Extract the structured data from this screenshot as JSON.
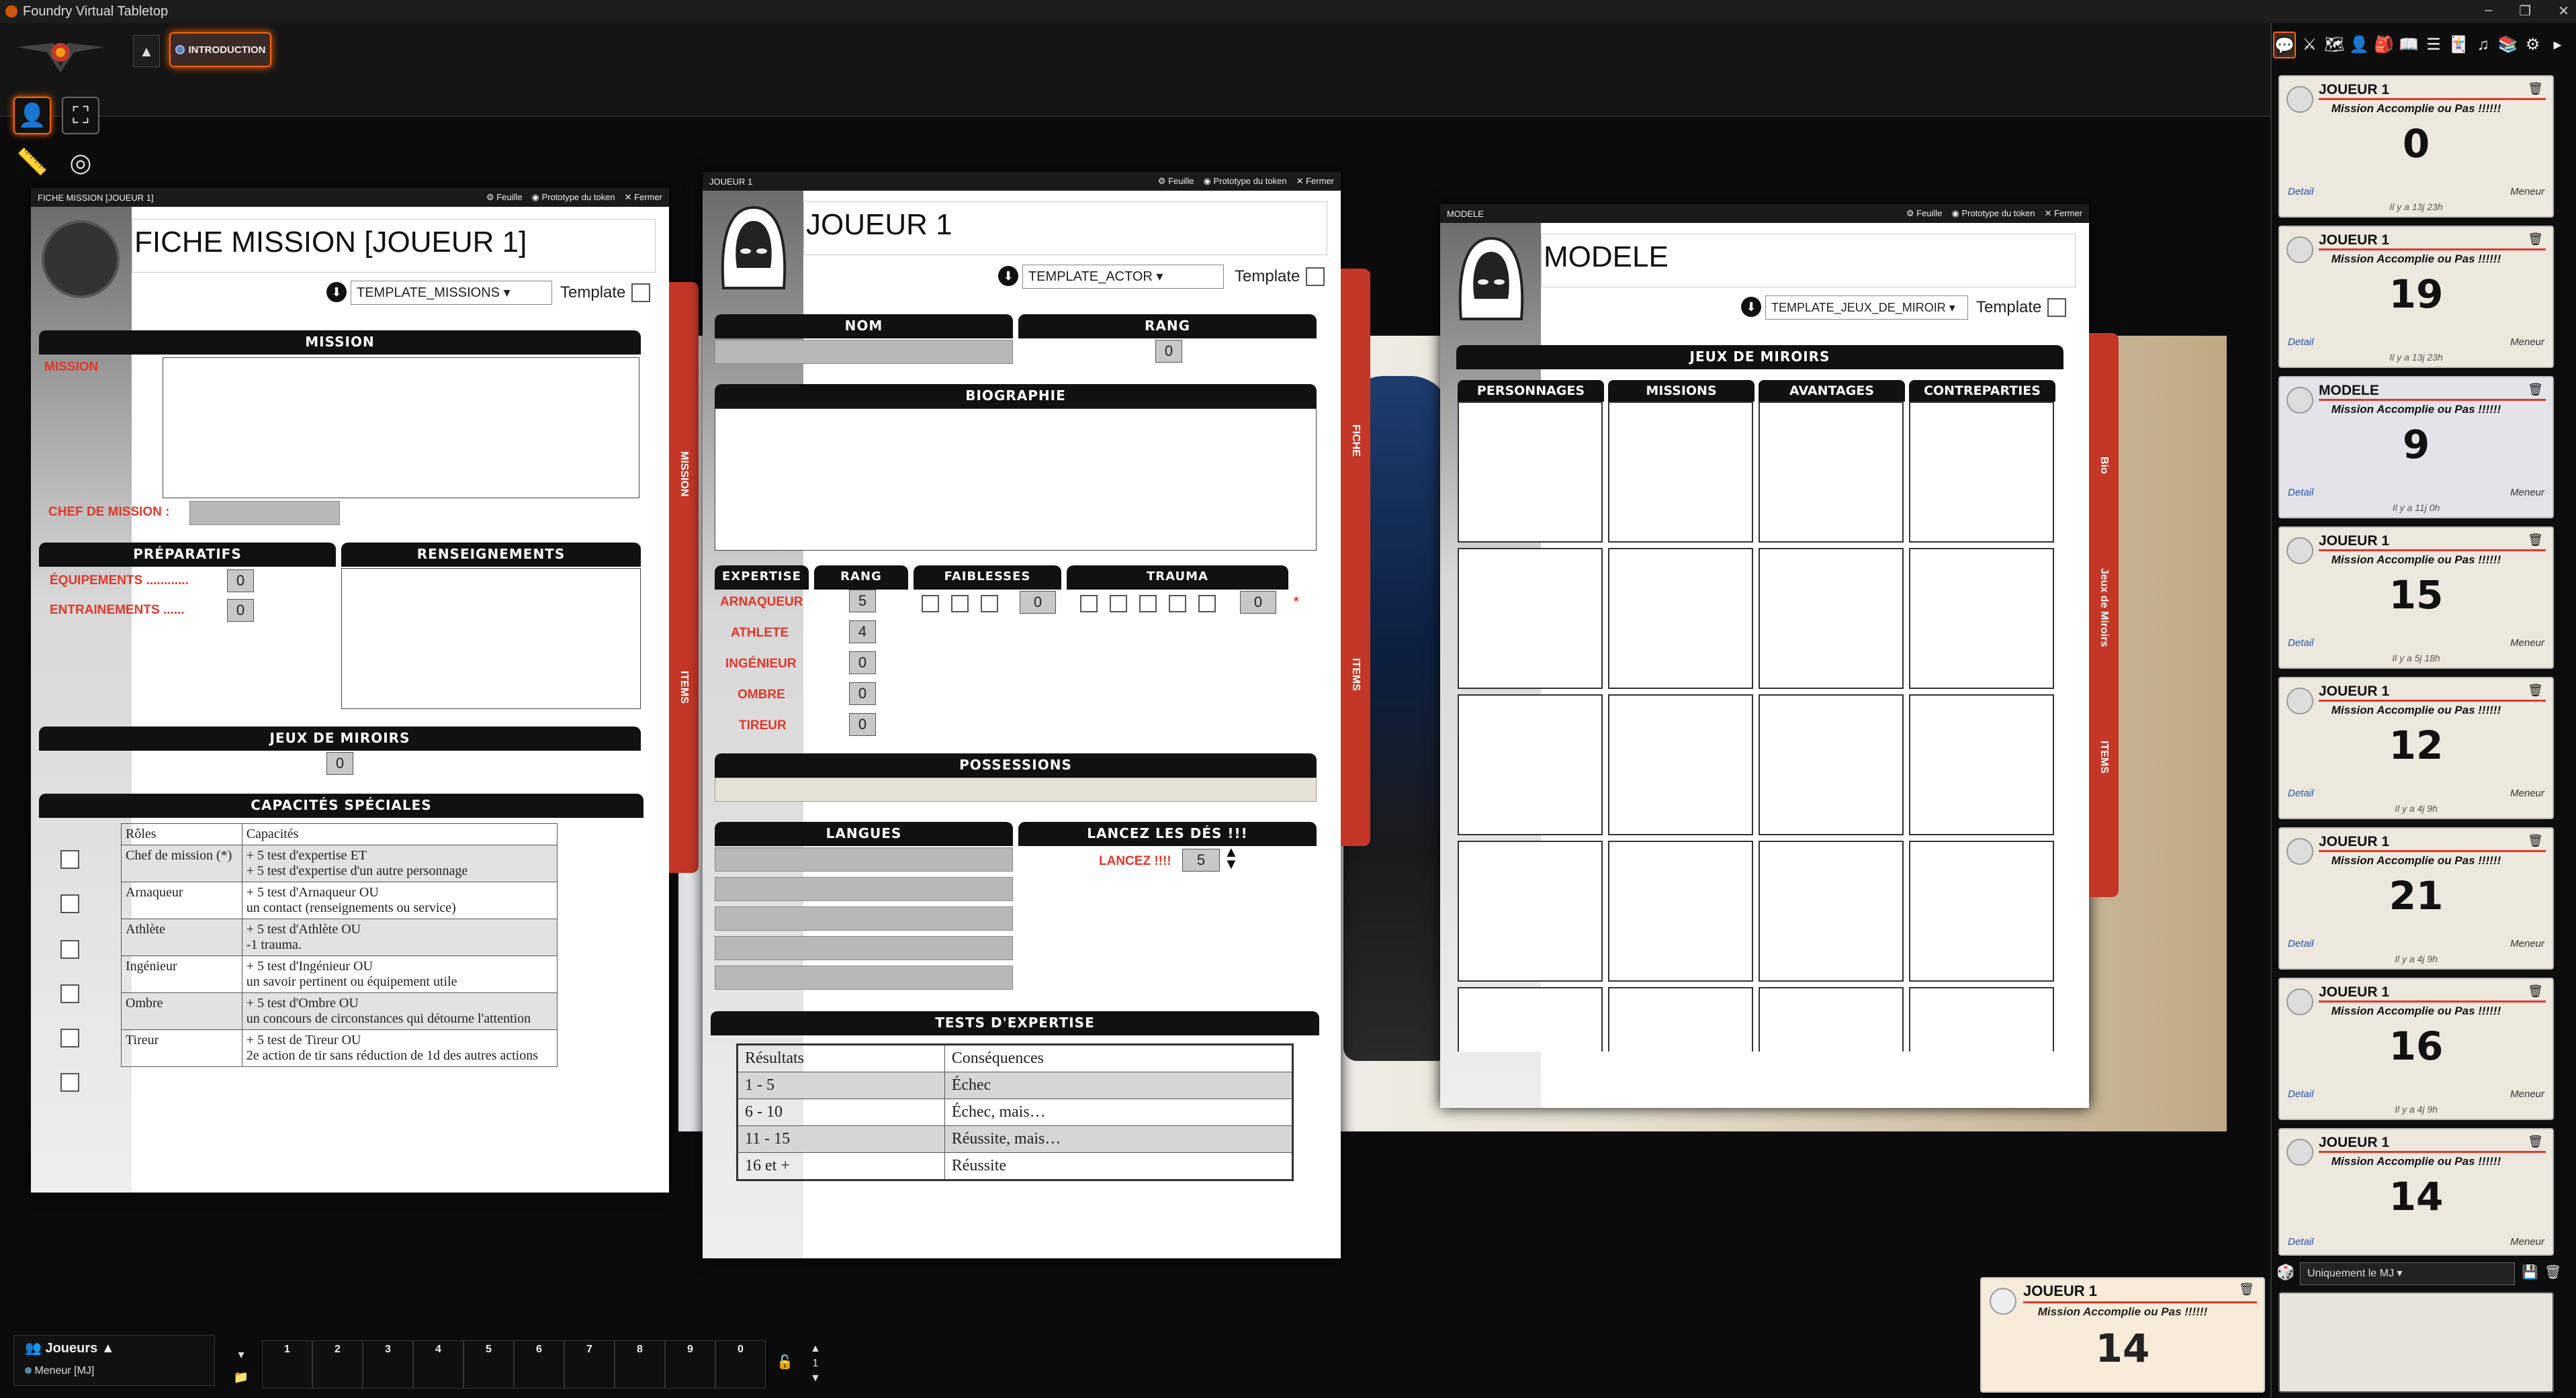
{
  "window": {
    "title": "Foundry Virtual Tabletop",
    "controls": [
      "–",
      "❐",
      "✕"
    ]
  },
  "scene_nav": {
    "active_scene": "INTRODUCTION"
  },
  "sheets": {
    "mission": {
      "header": "FICHE MISSION [JOUEUR 1]",
      "buttons": {
        "feuille": "Feuille",
        "prototype": "Prototype du token",
        "fermer": "Fermer"
      },
      "title": "FICHE MISSION [JOUEUR 1]",
      "template_select": "TEMPLATE_MISSIONS",
      "template_label": "Template",
      "mission_banner": "MISSION",
      "mission_label": "MISSION",
      "chef_label": "CHEF DE MISSION :",
      "preparatifs_banner": "PRÉPARATIFS",
      "renseignements_banner": "RENSEIGNEMENTS",
      "equipements_label": "ÉQUIPEMENTS ............",
      "equipements_value": "0",
      "entrainements_label": "ENTRAINEMENTS ......",
      "entrainements_value": "0",
      "miroirs_banner": "JEUX DE MIROIRS",
      "miroirs_value": "0",
      "capacites_banner": "CAPACITÉS SPÉCIALES",
      "caps_header": [
        "Rôles",
        "Capacités"
      ],
      "caps_rows": [
        [
          "Chef de mission (*)",
          "+ 5 test d'expertise ET",
          "+ 5 test d'expertise d'un autre personnage"
        ],
        [
          "Arnaqueur",
          "+ 5 test d'Arnaqueur OU",
          "un contact (renseignements ou service)"
        ],
        [
          "Athlète",
          "+ 5 test d'Athlète OU",
          "-1 trauma."
        ],
        [
          "Ingénieur",
          "+ 5 test d'Ingénieur OU",
          "un savoir pertinent ou équipement utile"
        ],
        [
          "Ombre",
          "+ 5 test d'Ombre OU",
          "un concours de circonstances qui détourne l'attention"
        ],
        [
          "Tireur",
          "+ 5 test de Tireur OU",
          "2e action de tir sans réduction de 1d des autres actions"
        ]
      ],
      "tabs": [
        "MISSION",
        "ITEMS"
      ]
    },
    "actor": {
      "header": "JOUEUR 1",
      "buttons": {
        "feuille": "Feuille",
        "prototype": "Prototype du token",
        "fermer": "Fermer"
      },
      "title": "JOUEUR 1",
      "template_select": "TEMPLATE_ACTOR",
      "template_label": "Template",
      "nom_banner": "NOM",
      "rang_banner": "RANG",
      "rang_value": "0",
      "bio_banner": "BIOGRAPHIE",
      "expertise_banner": "EXPERTISE",
      "rang_col_banner": "RANG",
      "faiblesses_banner": "FAIBLESSES",
      "trauma_banner": "TRAUMA",
      "expertises": [
        {
          "label": "ARNAQUEUR",
          "value": "5"
        },
        {
          "label": "ATHLETE",
          "value": "4"
        },
        {
          "label": "INGÉNIEUR",
          "value": "0"
        },
        {
          "label": "OMBRE",
          "value": "0"
        },
        {
          "label": "TIREUR",
          "value": "0"
        }
      ],
      "faiblesses_value": "0",
      "trauma_value": "0",
      "star": "*",
      "possessions_banner": "POSSESSIONS",
      "langues_banner": "LANGUES",
      "lancez_banner": "LANCEZ LES DÉS !!!",
      "lancez_label": "LANCEZ !!!!",
      "lancez_value": "5",
      "tests_banner": "TESTS D'EXPERTISE",
      "res_header": [
        "Résultats",
        "Conséquences"
      ],
      "res_rows": [
        [
          "1 - 5",
          "Échec"
        ],
        [
          "6 - 10",
          "Échec, mais…"
        ],
        [
          "11 - 15",
          "Réussite, mais…"
        ],
        [
          "16 et +",
          "Réussite"
        ]
      ],
      "tabs": [
        "FICHE",
        "ITEMS"
      ]
    },
    "modele": {
      "header": "MODELE",
      "buttons": {
        "feuille": "Feuille",
        "prototype": "Prototype du token",
        "fermer": "Fermer"
      },
      "title": "MODELE",
      "template_select": "TEMPLATE_JEUX_DE_MIROIR",
      "template_label": "Template",
      "miroirs_banner": "JEUX DE MIROIRS",
      "cols": [
        "PERSONNAGES",
        "MISSIONS",
        "AVANTAGES",
        "CONTREPARTIES"
      ],
      "tabs": [
        "Bio",
        "Jeux de Miroirs",
        "ITEMS"
      ]
    }
  },
  "chat": {
    "flavor": "Mission Accomplie ou Pas !!!!!!",
    "detail": "Detail",
    "meneur": "Meneur",
    "messages": [
      {
        "who": "JOUEUR 1",
        "result": "0",
        "ts": "Il y a 13j 23h"
      },
      {
        "who": "JOUEUR 1",
        "result": "19",
        "ts": "Il y a 13j 23h"
      },
      {
        "who": "MODELE",
        "result": "9",
        "ts": "Il y a 11j 0h"
      },
      {
        "who": "JOUEUR 1",
        "result": "15",
        "ts": "Il y a 5j 18h"
      },
      {
        "who": "JOUEUR 1",
        "result": "12",
        "ts": "Il y a 4j 9h"
      },
      {
        "who": "JOUEUR 1",
        "result": "21",
        "ts": "Il y a 4j 9h"
      },
      {
        "who": "JOUEUR 1",
        "result": "16",
        "ts": "Il y a 4j 9h"
      },
      {
        "who": "JOUEUR 1",
        "result": "14",
        "ts": ""
      }
    ],
    "roll_mode": "Uniquement le MJ"
  },
  "toast": {
    "who": "JOUEUR 1",
    "flavor": "Mission Accomplie ou Pas !!!!!!",
    "result": "14"
  },
  "players": {
    "title": "Joueurs",
    "list": [
      "Meneur [MJ]"
    ]
  },
  "hotbar": {
    "slots": [
      "1",
      "2",
      "3",
      "4",
      "5",
      "6",
      "7",
      "8",
      "9",
      "0"
    ],
    "page": "1"
  }
}
